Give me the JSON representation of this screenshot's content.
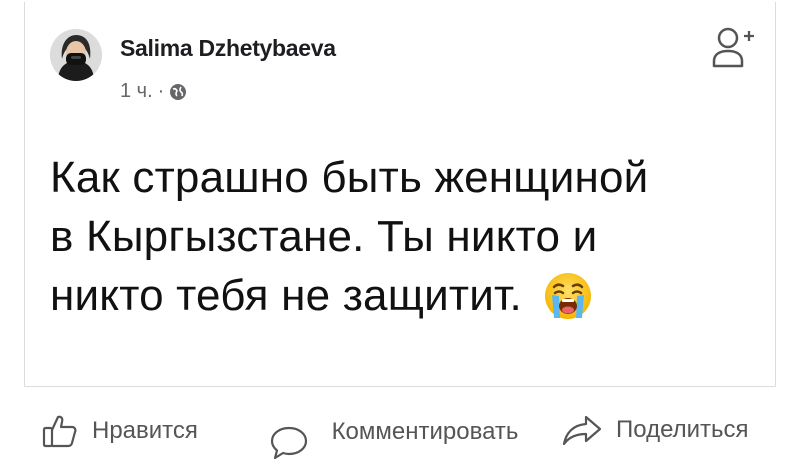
{
  "post": {
    "author": "Salima Dzhetybaeva",
    "time": "1 ч.",
    "separator": "·",
    "text_lines": [
      "Как страшно быть женщиной",
      "в Кыргызстане. Ты никто и",
      "никто тебя не защитит."
    ],
    "emoji": "crying-face"
  },
  "actions": {
    "like": "Нравится",
    "comment": "Комментировать",
    "share": "Поделиться"
  },
  "icons": [
    "globe-icon",
    "add-friend-icon",
    "like-icon",
    "comment-icon",
    "share-icon"
  ],
  "colors": {
    "text": "#111111",
    "meta": "#65676b",
    "action": "#555555",
    "border": "#dcdcdc"
  }
}
